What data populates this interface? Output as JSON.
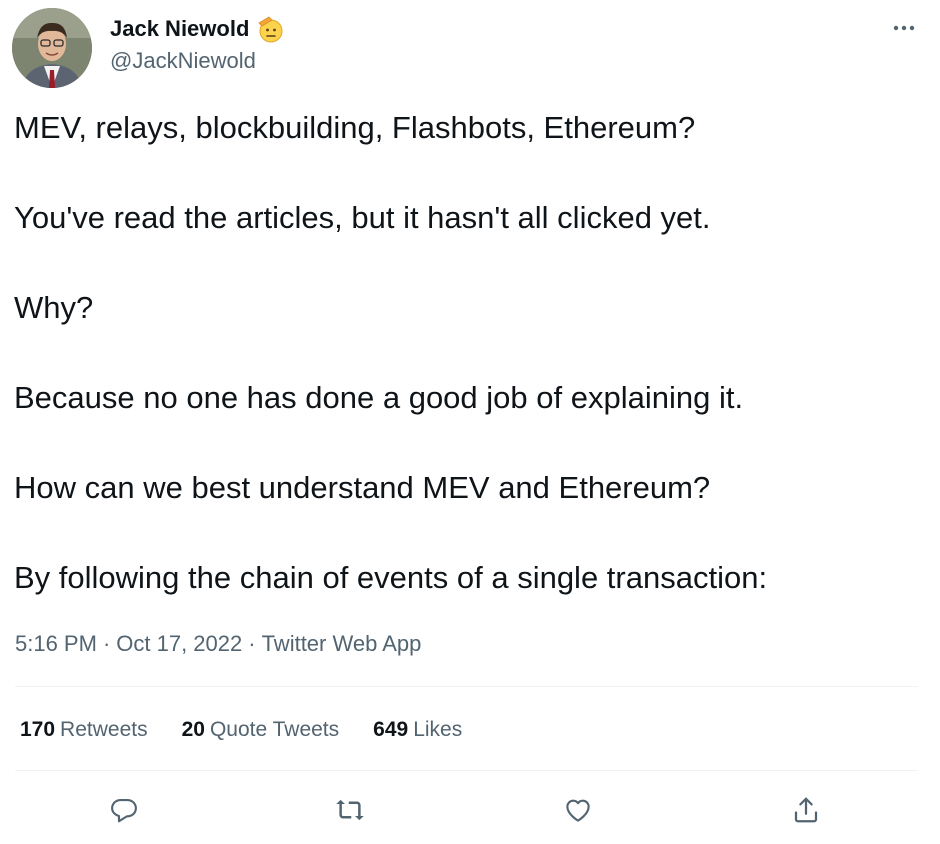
{
  "author": {
    "name": "Jack Niewold",
    "handle": "@JackNiewold"
  },
  "tweet": {
    "paragraphs": [
      "MEV, relays, blockbuilding, Flashbots, Ethereum?",
      "You've read the articles, but it hasn't all clicked yet.",
      "Why?",
      "Because no one has done a good job of explaining it.",
      "How can we best understand MEV and Ethereum?",
      "By following the chain of events of a single transaction:"
    ],
    "time": "5:16 PM",
    "date": "Oct 17, 2022",
    "source": "Twitter Web App",
    "separator": "·"
  },
  "stats": {
    "retweets": {
      "count": "170",
      "label": "Retweets"
    },
    "quotes": {
      "count": "20",
      "label": "Quote Tweets"
    },
    "likes": {
      "count": "649",
      "label": "Likes"
    }
  },
  "icons": {
    "badge": "saluting-face-emoji-icon",
    "more": "more-options-icon",
    "reply": "reply-icon",
    "retweet": "retweet-icon",
    "like": "like-icon",
    "share": "share-icon"
  },
  "colors": {
    "text": "#0f1419",
    "secondary": "#536471",
    "divider": "#eff3f4"
  }
}
